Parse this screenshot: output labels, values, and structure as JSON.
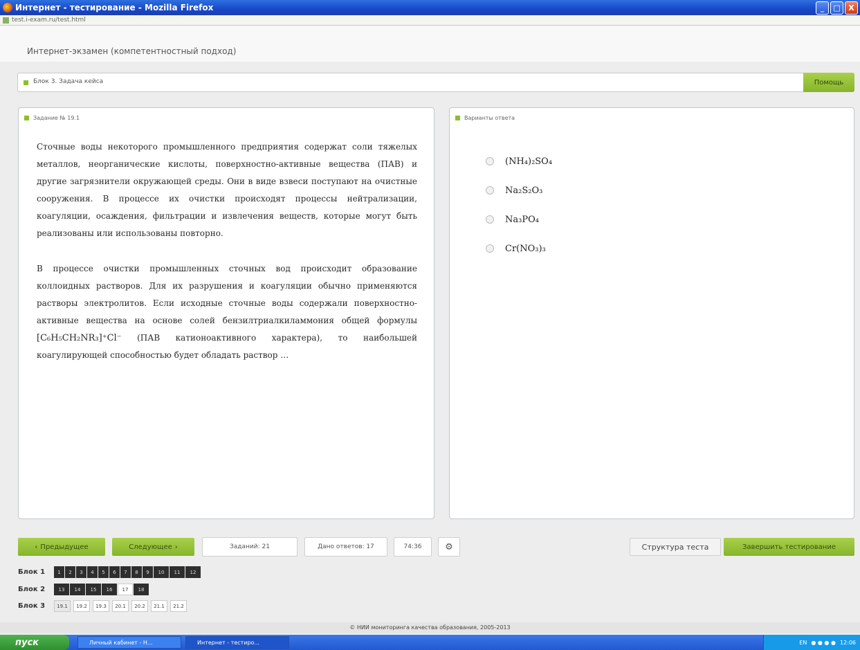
{
  "window": {
    "title": "Интернет - тестирование - Mozilla Firefox",
    "address": "test.i-exam.ru/test.html",
    "controls": [
      "_",
      "□",
      "X"
    ]
  },
  "app": {
    "title": "Интернет-экзамен (компетентностный подход)"
  },
  "block_header": {
    "label": "Блок 3. Задача кейса",
    "help_label": "Помощь"
  },
  "task": {
    "header": "Задание № 19.1",
    "paragraph1": "Сточные воды некоторого промышленного предприятия содержат соли тяжелых металлов, неорганические кислоты, поверхностно-активные вещества (ПАВ) и другие загрязнители окружающей среды. Они в виде взвеси поступают на очистные сооружения. В процессе их очистки происходят процессы нейтрализации, коагуляции, осаждения, фильтрации и извлечения веществ, которые могут быть реализованы или использованы повторно.",
    "paragraph2_start": "В процессе очистки промышленных сточных вод происходит образование коллоидных растворов. Для их разрушения и коагуляции обычно применяются растворы электролитов. Если исходные сточные воды содержали поверхностно-активные вещества на основе солей бензилтриалкиламмония общей формулы",
    "formula": "[C₆H₅CH₂NR₃]⁺Cl⁻",
    "paragraph2_end": "(ПАВ катионоактивного характера), то наибольшей коагулирующей способностью будет обладать раствор …"
  },
  "answers": {
    "header": "Варианты ответа",
    "options": [
      "(NH₄)₂SO₄",
      "Na₂S₂O₃",
      "Na₃PO₄",
      "Cr(NO₃)₃"
    ]
  },
  "toolbar": {
    "prev_label": "Предыдущее",
    "next_label": "Следующее",
    "tasks_count": "Заданий: 21",
    "answered_count": "Дано ответов: 17",
    "timer": "74:36",
    "structure_label": "Структура теста",
    "finish_label": "Завершить тестирование"
  },
  "grid": {
    "block1": {
      "label": "Блок 1",
      "cells": [
        "1",
        "2",
        "3",
        "4",
        "5",
        "6",
        "7",
        "8",
        "9",
        "10",
        "11",
        "12"
      ]
    },
    "block2": {
      "label": "Блок 2",
      "cells": [
        "13",
        "14",
        "15",
        "16",
        "17",
        "18"
      ]
    },
    "block3": {
      "label": "Блок 3",
      "cells": [
        "19.1",
        "19.2",
        "19.3",
        "20.1",
        "20.2",
        "21.1",
        "21.2"
      ]
    }
  },
  "footer": {
    "text": "© НИИ мониторинга качества образования, 2005-2013"
  },
  "taskbar": {
    "start_label": "пуск",
    "items": [
      "Личный кабинет - Н...",
      "Интернет - тестиро..."
    ],
    "lang": "EN",
    "clock": "12:06"
  },
  "colors": {
    "accent_green": "#8cbf2a",
    "answered_cell": "#2e2e2e",
    "title_bar": "#1848c8"
  }
}
